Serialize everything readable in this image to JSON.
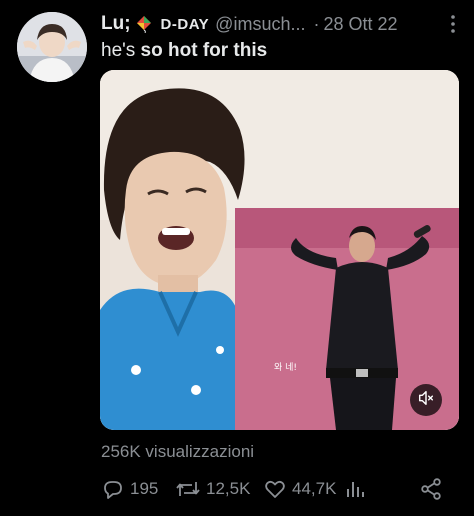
{
  "tweet": {
    "display_name": "Lu;",
    "name_emoji": "kite-emoji",
    "dday_label": "D-DAY",
    "handle": "@imsuch...",
    "separator": "·",
    "date": "28 Ott 22",
    "text_plain": "he's ",
    "text_bold": "so hot for this",
    "views": "256K visualizzazioni"
  },
  "media": {
    "overlay_text": "와 네!"
  },
  "actions": {
    "replies": "195",
    "retweets": "12,5K",
    "likes": "44,7K"
  },
  "icons": {
    "more": "more-vertical-icon",
    "reply": "reply-icon",
    "retweet": "retweet-icon",
    "like": "heart-icon",
    "analytics": "analytics-icon",
    "share": "share-icon",
    "mute": "volume-mute-icon"
  },
  "colors": {
    "background": "#000000",
    "text_primary": "#e7e9ea",
    "text_secondary": "#8b8f94"
  }
}
